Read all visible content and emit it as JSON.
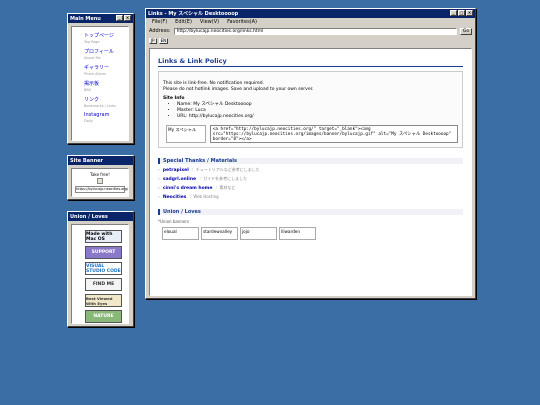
{
  "main_menu": {
    "title": "Main Menu",
    "items": [
      {
        "label": "トップページ",
        "sub": "Top Page"
      },
      {
        "label": "プロフィール",
        "sub": "About Me"
      },
      {
        "label": "ギャラリー",
        "sub": "Photo Album"
      },
      {
        "label": "掲示板",
        "sub": "BBS"
      },
      {
        "label": "リンク",
        "sub": "Bookmarks / Links"
      },
      {
        "label": "Instagram",
        "sub": "Daily"
      }
    ]
  },
  "site_banner": {
    "title": "Site Banner",
    "take_free": "Take free!",
    "url": "https://bylucajp.neocities.org/"
  },
  "union_loves": {
    "title": "Union / Loves",
    "badges": [
      {
        "label": "Made with Mac OS",
        "bg": "#e8eef8",
        "color": "#000"
      },
      {
        "label": "SUPPORT",
        "bg": "#8a78c8",
        "color": "#ffffff"
      },
      {
        "label": "VISUAL STUDIO CODE",
        "bg": "#ffffff",
        "color": "#1a6fc0"
      },
      {
        "label": "FIND ME",
        "bg": "#f4f4f4",
        "color": "#333"
      },
      {
        "label": "Best Viewed With Eyes",
        "bg": "#f0e8c8",
        "color": "#333"
      },
      {
        "label": "NATURE",
        "bg": "#8ab878",
        "color": "#ffffff"
      }
    ]
  },
  "browser": {
    "title": "Links - My スペシャル Desktoooop",
    "menu": [
      "File(F)",
      "Edit(E)",
      "View(V)",
      "Favorites(A)"
    ],
    "address_label": "Address:",
    "address": "http://bylucajp.neocities.org/links.html",
    "go": "Go",
    "lang": [
      "JP",
      "EN"
    ]
  },
  "page": {
    "heading": "Links & Link Policy",
    "policy_lines": [
      "This site is link-free. No notification required.",
      "Please do not hotlink images. Save and upload to your own server."
    ],
    "site_info_title": "Site Info",
    "site_info": [
      "Name: My スペシャル Desktoooop",
      "Master: Luca",
      "URL: http://bylucajp.neocities.org/"
    ],
    "banner_alt": "My スペシャル",
    "code": "<a href=\"http://bylucajp.neocities.org/\" target=\"_blank\"><img src=\"https://bylucajp.neocities.org/images/banner/bylucajp.gif\" alt=\"My スペシャル Desktoooop\" border=\"0\"></a>",
    "thanks_title": "Special Thanks / Materials",
    "thanks": [
      {
        "name": "petrapixel",
        "desc": "：チュートリアルなど参考にしました"
      },
      {
        "name": "sadgrl.online",
        "desc": "：ガイドを参考にしました"
      },
      {
        "name": "cinni's dream home",
        "desc": "：素材など"
      },
      {
        "name": "Neocities",
        "desc": "：Web Hosting"
      }
    ],
    "union_title": "Union / Loves",
    "union_note": "*Union banners",
    "union_banners": [
      "eloual",
      "stardewvalley",
      "jojo",
      "lilwarden"
    ]
  }
}
